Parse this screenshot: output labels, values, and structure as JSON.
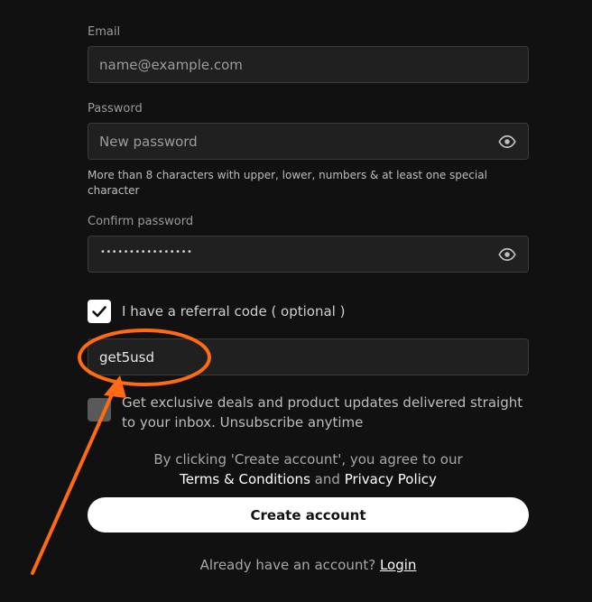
{
  "form": {
    "email": {
      "label": "Email",
      "placeholder": "name@example.com",
      "value": ""
    },
    "password": {
      "label": "Password",
      "placeholder": "New password",
      "value": "",
      "hint": "More than 8 characters with upper, lower, numbers & at least one special character",
      "toggle_icon": "eye-icon"
    },
    "confirm_password": {
      "label": "Confirm password",
      "masked_value": "••••••••••••••••",
      "toggle_icon": "eye-icon"
    },
    "referral": {
      "checkbox_checked": true,
      "checkbox_label": "I have a referral code ( optional )",
      "value": "get5usd"
    },
    "marketing": {
      "checkbox_checked": false,
      "label": "Get exclusive deals and product updates delivered straight to your inbox. Unsubscribe anytime"
    },
    "terms": {
      "prefix": "By clicking 'Create account', you agree to our",
      "terms_link": "Terms & Conditions",
      "and": "and",
      "privacy_link": "Privacy Policy"
    },
    "submit_label": "Create account",
    "login": {
      "prompt": "Already have an account?",
      "link": "Login"
    }
  },
  "annotation": {
    "color": "#ff6a13",
    "shape": "circle-and-arrow",
    "target": "referral-code-input"
  },
  "colors": {
    "background": "#101110",
    "field_background": "#1f201f",
    "field_border": "#3a3b3a",
    "button_background": "#ffffff"
  }
}
